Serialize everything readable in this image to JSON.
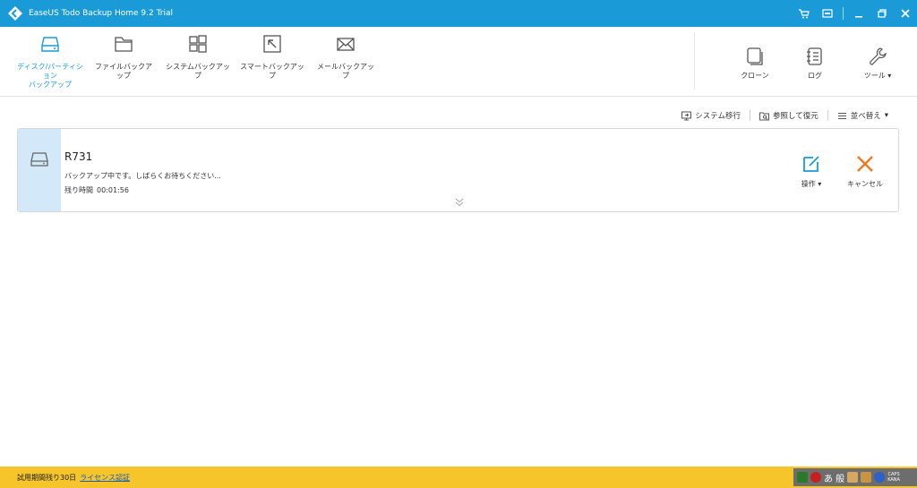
{
  "titlebar": {
    "title": "EaseUS Todo Backup Home 9.2 Trial",
    "icons": [
      "cart-icon",
      "message-icon",
      "minimize-icon",
      "restore-icon",
      "close-icon"
    ]
  },
  "toolbar": {
    "items": [
      {
        "label": "ディスク/パーティション\nバックアップ",
        "icon": "disk-icon",
        "active": true
      },
      {
        "label": "ファイルバックアップ",
        "icon": "folder-icon"
      },
      {
        "label": "システムバックアップ",
        "icon": "windows-icon"
      },
      {
        "label": "スマートバックアップ",
        "icon": "smart-icon"
      },
      {
        "label": "メールバックアップ",
        "icon": "mail-icon"
      }
    ],
    "right": [
      {
        "label": "クローン",
        "icon": "clone-icon"
      },
      {
        "label": "ログ",
        "icon": "log-icon"
      },
      {
        "label": "ツール",
        "icon": "wrench-icon"
      }
    ]
  },
  "actions": {
    "system_transfer": "システム移行",
    "browse_recover": "参照して復元",
    "sort": "並べ替え"
  },
  "task": {
    "name": "R731",
    "status": "バックアップ中です。しばらくお待ちください...",
    "remaining_label": "残り時間",
    "remaining_value": "00:01:56",
    "operate_label": "操作",
    "cancel_label": "キャンセル"
  },
  "bottom": {
    "trial_text": "試用期間残り30日",
    "license_link": "ライセンス認証",
    "ime_text": "あ 般"
  },
  "colors": {
    "accent": "#1a9bd8",
    "cancel": "#f07921",
    "status_bar": "#f6c52c"
  }
}
